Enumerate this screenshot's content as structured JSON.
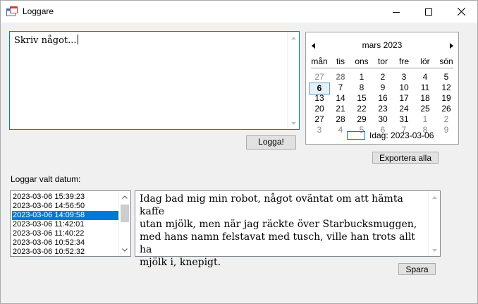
{
  "window": {
    "title": "Loggare",
    "icon": "app-window-icon",
    "controls": [
      "minimize-icon",
      "maximize-icon",
      "close-icon"
    ]
  },
  "input": {
    "text": "Skriv något..."
  },
  "log_button": {
    "label": "Logga!"
  },
  "calendar": {
    "month_label": "mars 2023",
    "weekdays": [
      "mån",
      "tis",
      "ons",
      "tor",
      "fre",
      "lör",
      "sön"
    ],
    "weeks": [
      [
        {
          "d": "27",
          "gray": true
        },
        {
          "d": "28",
          "gray": true,
          "bold": true
        },
        {
          "d": "1"
        },
        {
          "d": "2"
        },
        {
          "d": "3"
        },
        {
          "d": "4"
        },
        {
          "d": "5"
        }
      ],
      [
        {
          "d": "6",
          "selected": true,
          "bold": true
        },
        {
          "d": "7"
        },
        {
          "d": "8"
        },
        {
          "d": "9"
        },
        {
          "d": "10"
        },
        {
          "d": "11"
        },
        {
          "d": "12"
        }
      ],
      [
        {
          "d": "13"
        },
        {
          "d": "14"
        },
        {
          "d": "15"
        },
        {
          "d": "16"
        },
        {
          "d": "17"
        },
        {
          "d": "18"
        },
        {
          "d": "19"
        }
      ],
      [
        {
          "d": "20"
        },
        {
          "d": "21"
        },
        {
          "d": "22"
        },
        {
          "d": "23"
        },
        {
          "d": "24"
        },
        {
          "d": "25"
        },
        {
          "d": "26"
        }
      ],
      [
        {
          "d": "27"
        },
        {
          "d": "28"
        },
        {
          "d": "29"
        },
        {
          "d": "30"
        },
        {
          "d": "31"
        },
        {
          "d": "1",
          "gray": true
        },
        {
          "d": "2",
          "gray": true
        }
      ],
      [
        {
          "d": "3",
          "gray": true
        },
        {
          "d": "4",
          "gray": true
        },
        {
          "d": "5",
          "gray": true
        },
        {
          "d": "6",
          "gray": true
        },
        {
          "d": "7",
          "gray": true
        },
        {
          "d": "8",
          "gray": true
        },
        {
          "d": "9",
          "gray": true
        }
      ]
    ],
    "today_label": "Idag: 2023-03-06"
  },
  "export_button": {
    "label": "Exportera alla"
  },
  "logs_label": "Loggar valt datum:",
  "log_entries": [
    "2023-03-06 15:39:23",
    "2023-03-06 14:56:50",
    "2023-03-06 14:09:58",
    "2023-03-06 11:42:01",
    "2023-03-06 11:40:22",
    "2023-03-06 10:52:34",
    "2023-03-06 10:52:32"
  ],
  "selected_entry_index": 2,
  "entry_text": "Idag bad mig min robot, något oväntat om att hämta kaffe\nutan mjölk, men när jag räckte över Starbucksmuggen,\nmed hans namn felstavat med tusch, ville han trots allt ha\nmjölk i, knepigt.",
  "save_button": {
    "label": "Spara"
  },
  "colors": {
    "accent": "#0078d7",
    "window_bg": "#f0f0f0",
    "button_bg": "#e1e1e1"
  }
}
